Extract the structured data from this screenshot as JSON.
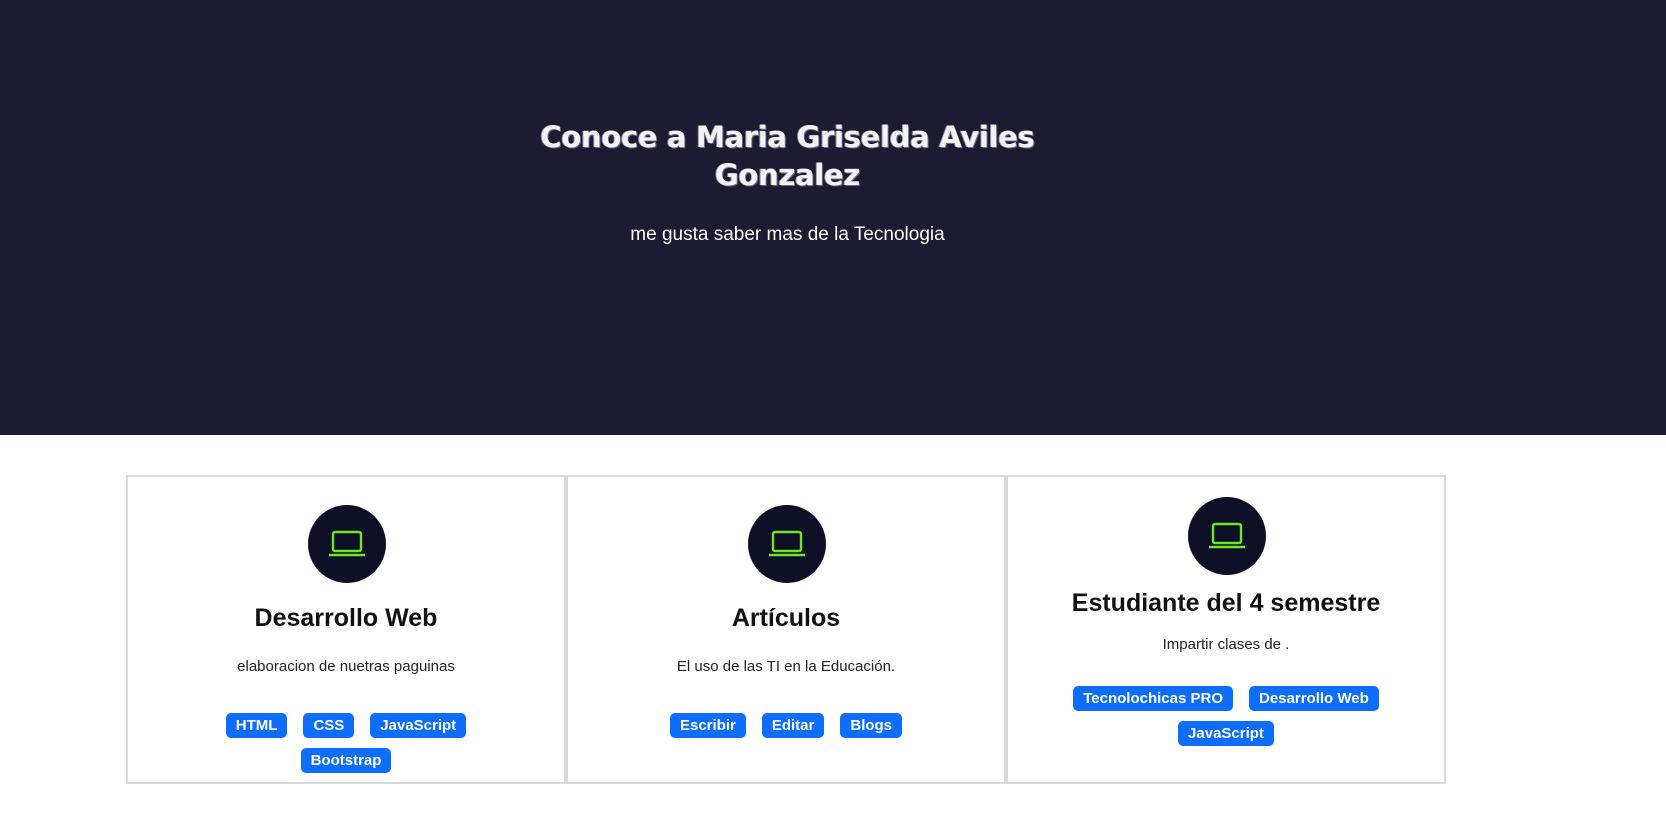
{
  "hero": {
    "title": "Conoce a Maria Griselda Aviles Gonzalez",
    "subtitle": "me gusta saber mas de la Tecnologia",
    "background_color": "#1b1c32"
  },
  "cards": [
    {
      "icon": "laptop-icon",
      "title": "Desarrollo Web",
      "description": "elaboracion de nuetras paguinas",
      "tags": [
        "HTML",
        "CSS",
        "JavaScript",
        "Bootstrap"
      ]
    },
    {
      "icon": "laptop-icon",
      "title": "Artículos",
      "description": "El uso de las TI en la Educación.",
      "tags": [
        "Escribir",
        "Editar",
        "Blogs"
      ]
    },
    {
      "icon": "laptop-icon",
      "title": "Estudiante del 4 semestre",
      "description": "Impartir clases de .",
      "tags": [
        "Tecnolochicas PRO",
        "Desarrollo Web",
        "JavaScript"
      ]
    }
  ],
  "colors": {
    "icon_circle": "#0d0f26",
    "icon_stroke": "#6fe62a",
    "tag_background": "#0d6efd",
    "card_border": "#d9d9d9"
  }
}
